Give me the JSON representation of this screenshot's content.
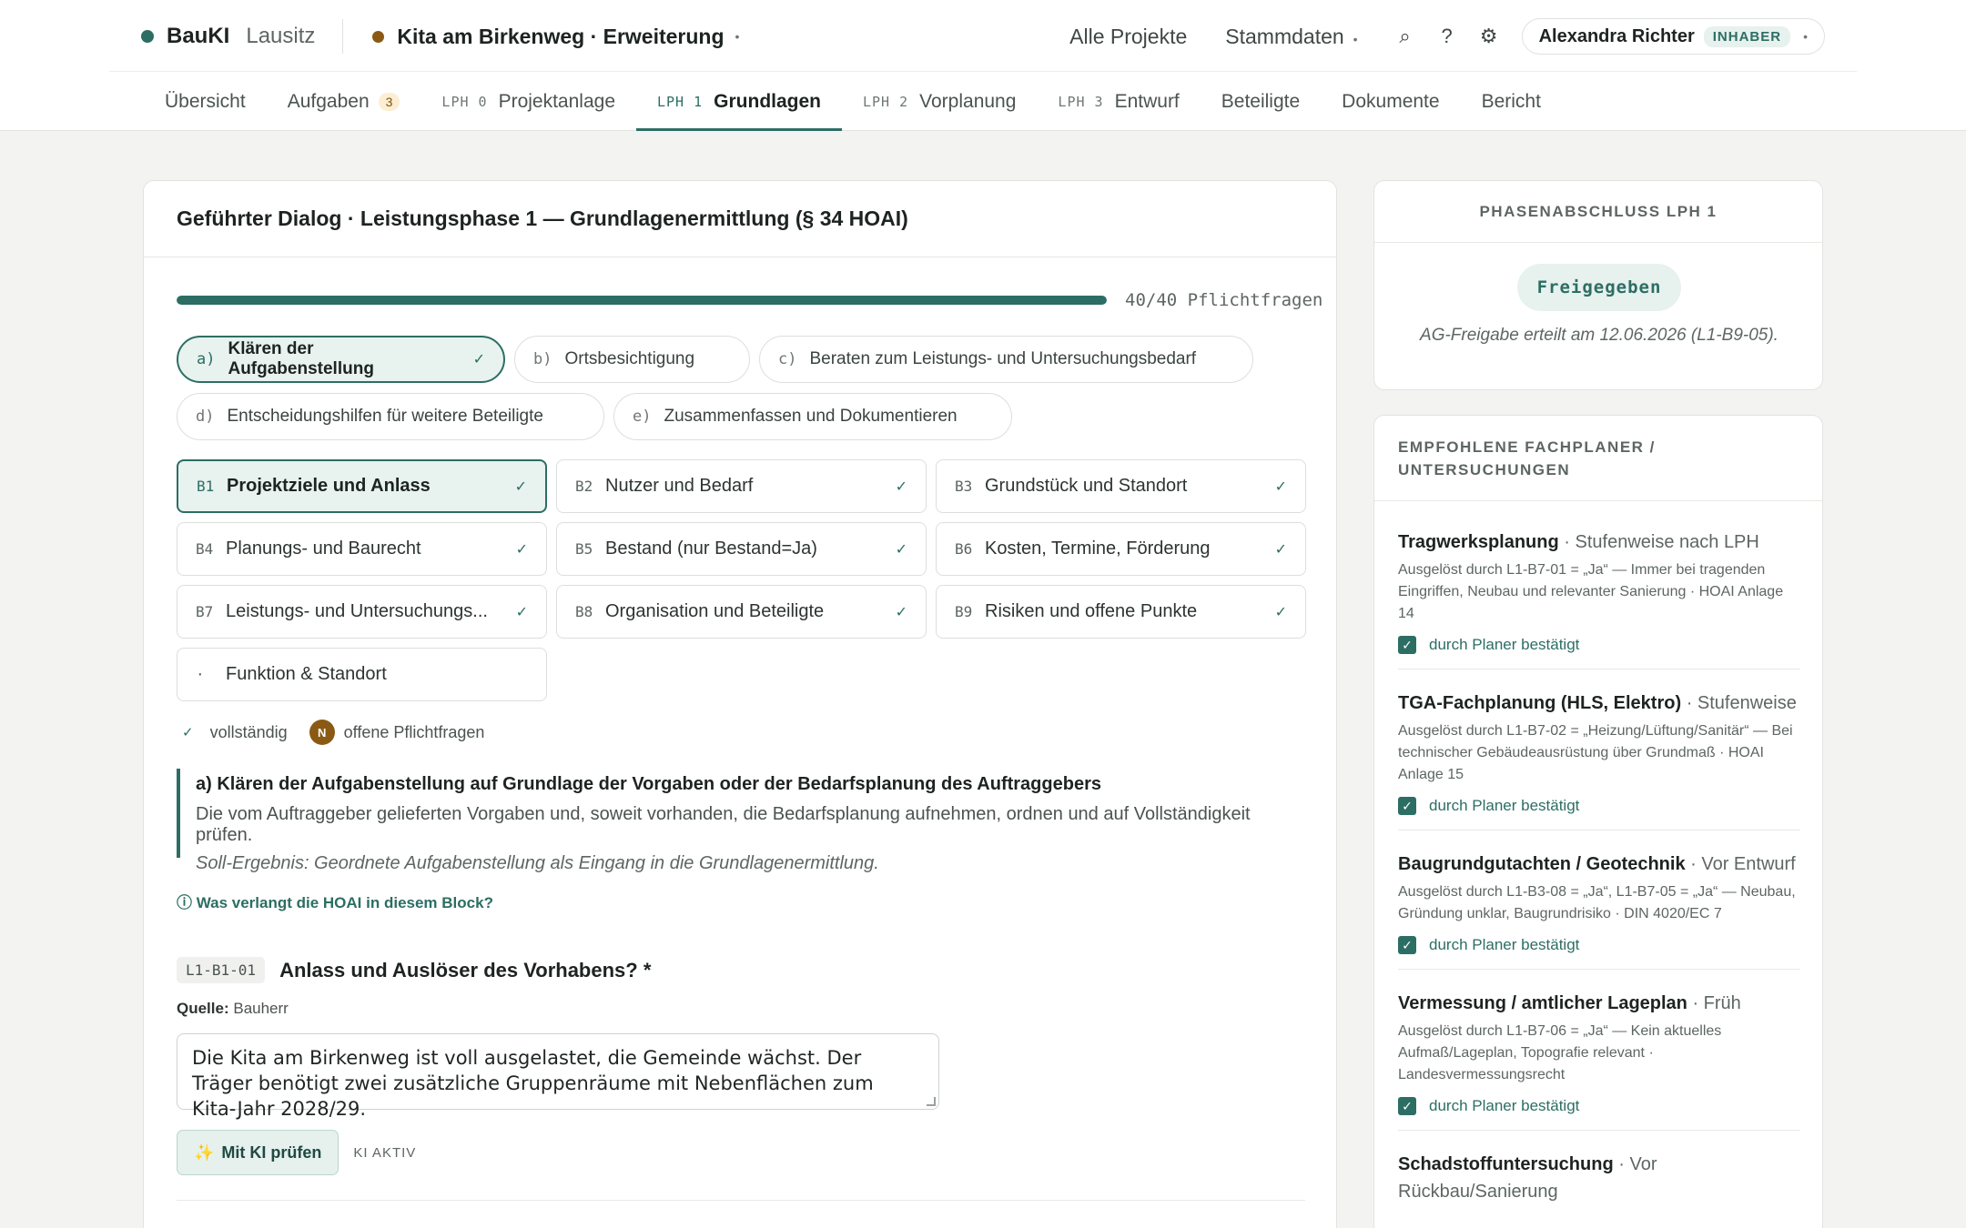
{
  "header": {
    "brand": "BauKI",
    "brand_sub": "Lausitz",
    "project": "Kita am Birkenweg · Erweiterung",
    "nav": {
      "all_projects": "Alle Projekte",
      "master_data": "Stammdaten"
    },
    "user": {
      "name": "Alexandra Richter",
      "role": "INHABER"
    }
  },
  "tabs": [
    {
      "label": "Übersicht"
    },
    {
      "label": "Aufgaben",
      "count": "3"
    },
    {
      "phase": "LPH 0",
      "label": "Projektanlage"
    },
    {
      "phase": "LPH 1",
      "label": "Grundlagen",
      "active": true
    },
    {
      "phase": "LPH 2",
      "label": "Vorplanung"
    },
    {
      "phase": "LPH 3",
      "label": "Entwurf"
    },
    {
      "label": "Beteiligte"
    },
    {
      "label": "Dokumente"
    },
    {
      "label": "Bericht"
    }
  ],
  "main": {
    "title": "Geführter Dialog · Leistungsphase 1 — Grundlagenermittlung (§ 34 HOAI)",
    "progress": {
      "value": 1.0,
      "text": "40/40 Pflichtfragen"
    },
    "pills": [
      {
        "letter": "a)",
        "label": "Klären der Aufgabenstellung",
        "check": "✓",
        "active": true
      },
      {
        "letter": "b)",
        "label": "Ortsbesichtigung"
      },
      {
        "letter": "c)",
        "label": "Beraten zum Leistungs- und Untersuchungsbedarf"
      },
      {
        "letter": "d)",
        "label": "Entscheidungshilfen für weitere Beteiligte"
      },
      {
        "letter": "e)",
        "label": "Zusammenfassen und Dokumentieren"
      }
    ],
    "blocks": [
      {
        "code": "B1",
        "label": "Projektziele und Anlass",
        "check": "✓",
        "active": true
      },
      {
        "code": "B2",
        "label": "Nutzer und Bedarf",
        "check": "✓"
      },
      {
        "code": "B3",
        "label": "Grundstück und Standort",
        "check": "✓"
      },
      {
        "code": "B4",
        "label": "Planungs- und Baurecht",
        "check": "✓"
      },
      {
        "code": "B5",
        "label": "Bestand (nur Bestand=Ja)",
        "check": "✓"
      },
      {
        "code": "B6",
        "label": "Kosten, Termine, Förderung",
        "check": "✓"
      },
      {
        "code": "B7",
        "label": "Leistungs- und Untersuchungs...",
        "check": "✓"
      },
      {
        "code": "B8",
        "label": "Organisation und Beteiligte",
        "check": "✓"
      },
      {
        "code": "B9",
        "label": "Risiken und offene Punkte",
        "check": "✓"
      },
      {
        "code": "·",
        "label": "Funktion & Standort",
        "check": ""
      }
    ],
    "legend": {
      "complete_mark": "✓",
      "complete": "vollständig",
      "open_mark": "N",
      "open": "offene Pflichtfragen"
    },
    "callout": {
      "title": "a) Klären der Aufgabenstellung auf Grundlage der Vorgaben oder der Bedarfsplanung des Auftraggebers",
      "text": "Die vom Auftraggeber gelieferten Vorgaben und, soweit vorhanden, die Bedarfsplanung aufnehmen, ordnen und auf Vollständigkeit prüfen.",
      "soll": "Soll-Ergebnis: Geordnete Aufgabenstellung als Eingang in die Grundlagenermittlung."
    },
    "hoai_link": "ⓘ Was verlangt die HOAI in diesem Block?",
    "question": {
      "code": "L1-B1-01",
      "title": "Anlass und Auslöser des Vorhabens? *",
      "source_label": "Quelle:",
      "source": "Bauherr",
      "answer": "Die Kita am Birkenweg ist voll ausgelastet, die Gemeinde wächst. Der Träger benötigt zwei zusätzliche Gruppenräume mit Nebenflächen zum Kita-Jahr 2028/29."
    },
    "ki_button": "Mit KI prüfen",
    "ki_status": "KI AKTIV"
  },
  "phase_close": {
    "title": "PHASENABSCHLUSS LPH 1",
    "status": "Freigegeben",
    "note": "AG-Freigabe erteilt am 12.06.2026 (L1-B9-05)."
  },
  "recommendations": {
    "title": "EMPFOHLENE FACHPLANER / UNTERSUCHUNGEN",
    "confirmed_label": "durch Planer bestätigt",
    "items": [
      {
        "name": "Tragwerksplanung",
        "timing": "Stufenweise nach LPH",
        "desc": "Ausgelöst durch L1-B7-01 = „Ja“ — Immer bei tragenden Eingriffen, Neubau und relevanter Sanierung · HOAI Anlage 14",
        "confirmed": true
      },
      {
        "name": "TGA-Fachplanung (HLS, Elektro)",
        "timing": "Stufenweise",
        "desc": "Ausgelöst durch L1-B7-02 = „Heizung/Lüftung/Sanitär“ — Bei technischer Gebäudeausrüstung über Grundmaß · HOAI Anlage 15",
        "confirmed": true
      },
      {
        "name": "Baugrundgutachten / Geotechnik",
        "timing": "Vor Entwurf",
        "desc": "Ausgelöst durch L1-B3-08 = „Ja“, L1-B7-05 = „Ja“ — Neubau, Gründung unklar, Baugrundrisiko · DIN 4020/EC 7",
        "confirmed": true
      },
      {
        "name": "Vermessung / amtlicher Lageplan",
        "timing": "Früh",
        "desc": "Ausgelöst durch L1-B7-06 = „Ja“ — Kein aktuelles Aufmaß/Lageplan, Topografie relevant · Landesvermessungsrecht",
        "confirmed": true
      },
      {
        "name": "Schadstoffuntersuchung",
        "timing": "Vor Rückbau/Sanierung",
        "desc": "",
        "confirmed": false
      }
    ]
  }
}
